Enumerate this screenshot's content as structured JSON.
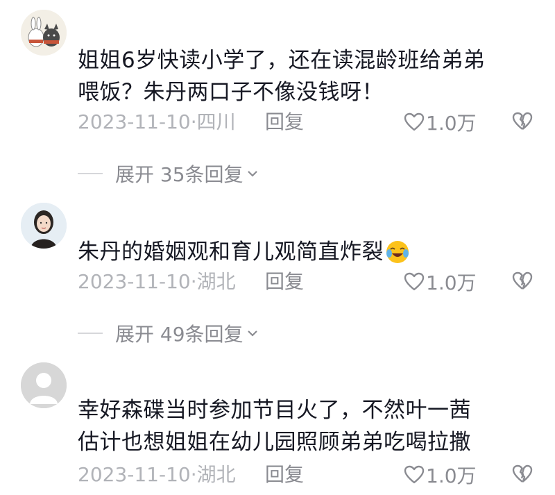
{
  "comments": [
    {
      "text": "姐姐6岁快读小学了，还在读混龄班给弟弟喂饭？朱丹两口子不像没钱呀！",
      "line1": "姐姐6岁快读小学了，还在读混龄班给弟弟",
      "line2": "喂饭？朱丹两口子不像没钱呀！",
      "date": "2023-11-10·四川",
      "reply_label": "回复",
      "likes": "1.0万",
      "expand_label": "展开 35条回复"
    },
    {
      "text": "朱丹的婚姻观和育儿观简直炸裂😭",
      "line1": "朱丹的婚姻观和育儿观简直炸裂",
      "date": "2023-11-10·湖北",
      "reply_label": "回复",
      "likes": "1.0万",
      "expand_label": "展开 49条回复"
    },
    {
      "text": "幸好森碟当时参加节目火了，不然叶一茜估计也想姐姐在幼儿园照顾弟弟吃喝拉撒",
      "line1": "幸好森碟当时参加节目火了，不然叶一茜",
      "line2": "估计也想姐姐在幼儿园照顾弟弟吃喝拉撒",
      "date": "2023-11-10·湖北",
      "reply_label": "回复",
      "likes": "1.0万"
    }
  ],
  "icons": {
    "like": "heart-outline-icon",
    "dislike": "broken-heart-icon",
    "expand": "chevron-down-icon",
    "emoji": "crying-laughing-emoji"
  }
}
